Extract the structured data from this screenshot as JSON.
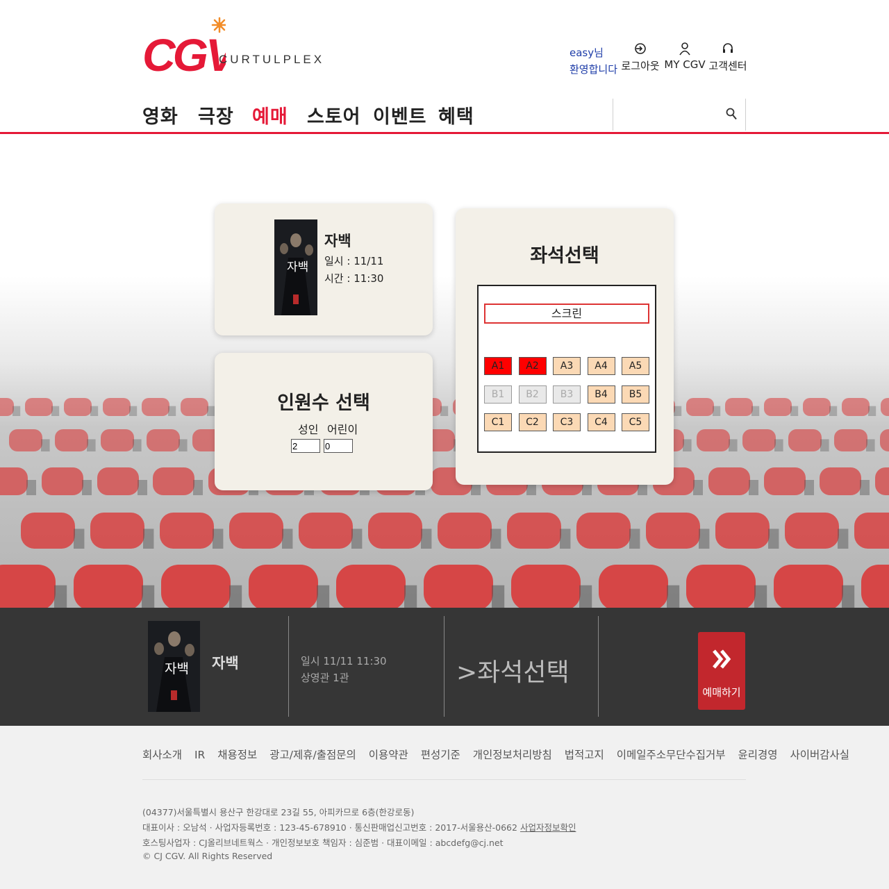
{
  "brand": {
    "logo_text": "CGV",
    "subtitle": "CURTULPLEX",
    "accent_color": "#e51937"
  },
  "header": {
    "welcome_user": "easy님",
    "welcome_text": "환영합니다",
    "links": [
      {
        "label": "로그아웃",
        "icon": "logout-icon"
      },
      {
        "label": "MY CGV",
        "icon": "user-icon"
      },
      {
        "label": "고객센터",
        "icon": "headset-icon"
      }
    ]
  },
  "nav": {
    "items": [
      "영화",
      "극장",
      "예매",
      "스토어",
      "이벤트",
      "혜택"
    ],
    "active": "예매",
    "search_placeholder": ""
  },
  "movie_card": {
    "poster_title": "자백",
    "title": "자백",
    "date": "일시 : 11/11",
    "time": "시간 : 11:30"
  },
  "people_card": {
    "title": "인원수 선택",
    "adult_label": "성인",
    "child_label": "어린이",
    "adult_value": "2",
    "child_value": "0"
  },
  "seat_card": {
    "title": "좌석선택",
    "screen_label": "스크린",
    "rows": [
      [
        {
          "id": "A1",
          "state": "selected"
        },
        {
          "id": "A2",
          "state": "selected"
        },
        {
          "id": "A3",
          "state": "available"
        },
        {
          "id": "A4",
          "state": "available"
        },
        {
          "id": "A5",
          "state": "available"
        }
      ],
      [
        {
          "id": "B1",
          "state": "sold"
        },
        {
          "id": "B2",
          "state": "sold"
        },
        {
          "id": "B3",
          "state": "sold"
        },
        {
          "id": "B4",
          "state": "available"
        },
        {
          "id": "B5",
          "state": "available"
        }
      ],
      [
        {
          "id": "C1",
          "state": "available"
        },
        {
          "id": "C2",
          "state": "available"
        },
        {
          "id": "C3",
          "state": "available"
        },
        {
          "id": "C4",
          "state": "available"
        },
        {
          "id": "C5",
          "state": "available"
        }
      ]
    ]
  },
  "booking_bar": {
    "movie_title": "자백",
    "datetime": "일시 11/11 11:30",
    "hall": "상영관 1관",
    "step": ">좌석선택",
    "book_button": "예매하기"
  },
  "footer": {
    "links": [
      "회사소개",
      "IR",
      "채용정보",
      "광고/제휴/출점문의",
      "이용약관",
      "편성기준",
      "개인정보처리방침",
      "법적고지",
      "이메일주소무단수집거부",
      "윤리경영",
      "사이버감사실"
    ],
    "address": "(04377)서울특별시 용산구 한강대로 23길 55, 아피카므로 6층(한강로동)",
    "ceo_line": "대표이사 : 오남석 · 사업자등록번호 : 123-45-678910 · 통신판매업신고번호 : 2017-서울용산-0662",
    "biz_link": "사업자정보확인",
    "hosting_line": "호스팅사업자 : CJ올리브네트웍스 · 개인정보보호 책임자 : 심준범 · 대표이메일 : abcdefg@cj.net",
    "copyright": "© CJ CGV. All Rights Reserved"
  }
}
